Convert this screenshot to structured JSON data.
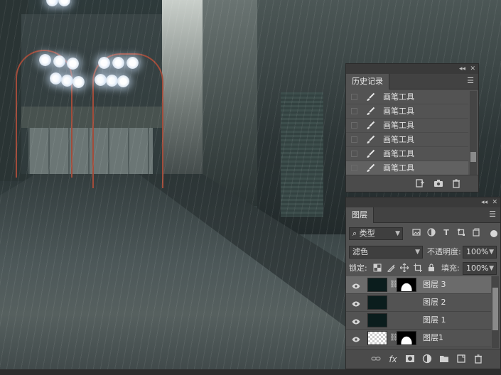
{
  "history_panel": {
    "tab_label": "历史记录",
    "collapse_glyph": "◂◂",
    "close_glyph": "✕",
    "menu_glyph": "☰",
    "items": [
      {
        "label": "画笔工具",
        "active": false
      },
      {
        "label": "画笔工具",
        "active": false
      },
      {
        "label": "画笔工具",
        "active": false
      },
      {
        "label": "画笔工具",
        "active": false
      },
      {
        "label": "画笔工具",
        "active": false
      },
      {
        "label": "画笔工具",
        "active": true
      }
    ],
    "footer_icons": [
      "new-document-from-state-icon",
      "camera-snapshot-icon",
      "trash-icon"
    ]
  },
  "layers_panel": {
    "tab_label": "图层",
    "collapse_glyph": "◂◂",
    "close_glyph": "✕",
    "menu_glyph": "☰",
    "filter": {
      "value": "类型",
      "search_glyph": "⌕"
    },
    "blend_mode": {
      "value": "滤色"
    },
    "opacity": {
      "label": "不透明度:",
      "value": "100%"
    },
    "lock": {
      "label": "锁定:"
    },
    "fill": {
      "label": "填充:",
      "value": "100%"
    },
    "layers": [
      {
        "name": "图层 3",
        "selected": true,
        "thumb": "dark",
        "has_mask": true,
        "visible": true
      },
      {
        "name": "图层 2",
        "selected": false,
        "thumb": "dark",
        "has_mask": false,
        "visible": true
      },
      {
        "name": "图层 1",
        "selected": false,
        "thumb": "dark",
        "has_mask": false,
        "visible": true
      },
      {
        "name": "图层1",
        "selected": false,
        "thumb": "transparent",
        "has_mask": true,
        "visible": true
      }
    ],
    "footer_icons": [
      "link-layers-icon",
      "fx-icon",
      "add-mask-icon",
      "adjustment-layer-icon",
      "new-group-icon",
      "new-layer-icon",
      "trash-icon"
    ],
    "fx_text": "fx"
  },
  "colors": {
    "panel_bg": "#535353",
    "panel_header": "#424242",
    "selected_row": "#6b6b6b",
    "lamp_pole": "#a24c3a"
  }
}
